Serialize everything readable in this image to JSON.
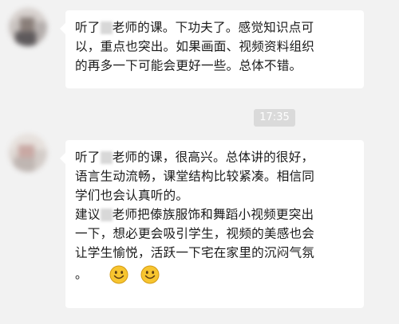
{
  "messages": [
    {
      "lines": [
        [
          "听了",
          "老师的课。下功夫了。感觉知识点可"
        ],
        [
          "以，重点也突出。如果画面、视频资料组织"
        ],
        [
          "的再多一下可能会更好一些。总体不错。"
        ]
      ]
    },
    {
      "lines": [
        [
          "听了",
          "老师的课，很高兴。总体讲的很好，"
        ],
        [
          "语言生动流畅，课堂结构比较紧凑。相信同"
        ],
        [
          "学们也会认真听的。"
        ],
        [
          "建议",
          "老师把傣族服饰和舞蹈小视频更突出"
        ],
        [
          "一下，想必更会吸引学生，视频的美感也会"
        ],
        [
          "让学生愉悦，活跃一下宅在家里的沉闷气氛"
        ],
        [
          "。"
        ]
      ],
      "emoji_icons": [
        "smile-emoji-icon",
        "smile-emoji-icon"
      ]
    }
  ],
  "timestamp": "17:35"
}
